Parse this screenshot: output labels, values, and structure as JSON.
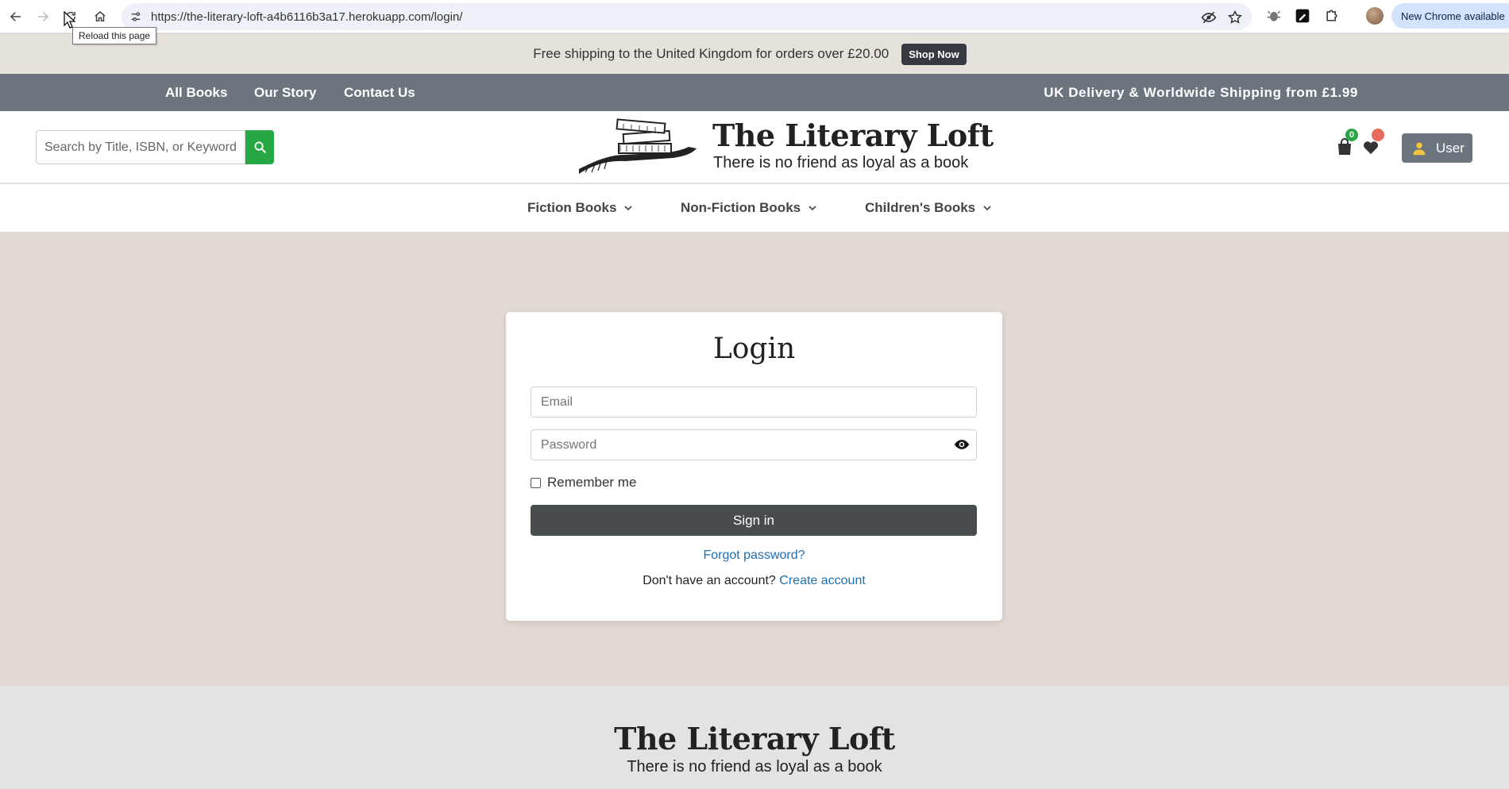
{
  "browser": {
    "url": "https://the-literary-loft-a4b6116b3a17.herokuapp.com/login/",
    "tooltip": "Reload this page",
    "update_label": "New Chrome available",
    "icons": [
      "back-icon",
      "forward-icon",
      "reload-icon",
      "home-icon",
      "site-info-icon",
      "eye-off-icon",
      "bookmark-star-icon",
      "extension-icon",
      "pen-icon",
      "puzzle-icon",
      "profile-avatar",
      "menu-dots-icon"
    ]
  },
  "promo": {
    "text": "Free shipping to the United Kingdom for orders over £20.00",
    "button": "Shop Now"
  },
  "topnav": {
    "links": [
      "All Books",
      "Our Story",
      "Contact Us"
    ],
    "delivery": "UK Delivery & Worldwide Shipping from £1.99"
  },
  "header": {
    "search_placeholder": "Search by Title, ISBN, or Keyword",
    "brand_title": "The Literary Loft",
    "brand_tagline": "There is no friend as loyal as a book",
    "cart_count": "0",
    "user_label": "User"
  },
  "categories": [
    "Fiction Books",
    "Non-Fiction Books",
    "Children's Books"
  ],
  "login": {
    "title": "Login",
    "email_placeholder": "Email",
    "password_placeholder": "Password",
    "remember_label": "Remember me",
    "signin_label": "Sign in",
    "forgot_label": "Forgot password?",
    "no_account_text": "Don't have an account?",
    "create_account_label": "Create account"
  },
  "footer": {
    "title": "The Literary Loft",
    "tagline": "There is no friend as loyal as a book"
  },
  "colors": {
    "page_bg": "#e2d9d2",
    "topnav_bg": "#6c757d",
    "search_green": "#28a745",
    "signin_bg": "#474c4e",
    "link_blue": "#1f6fb5"
  }
}
